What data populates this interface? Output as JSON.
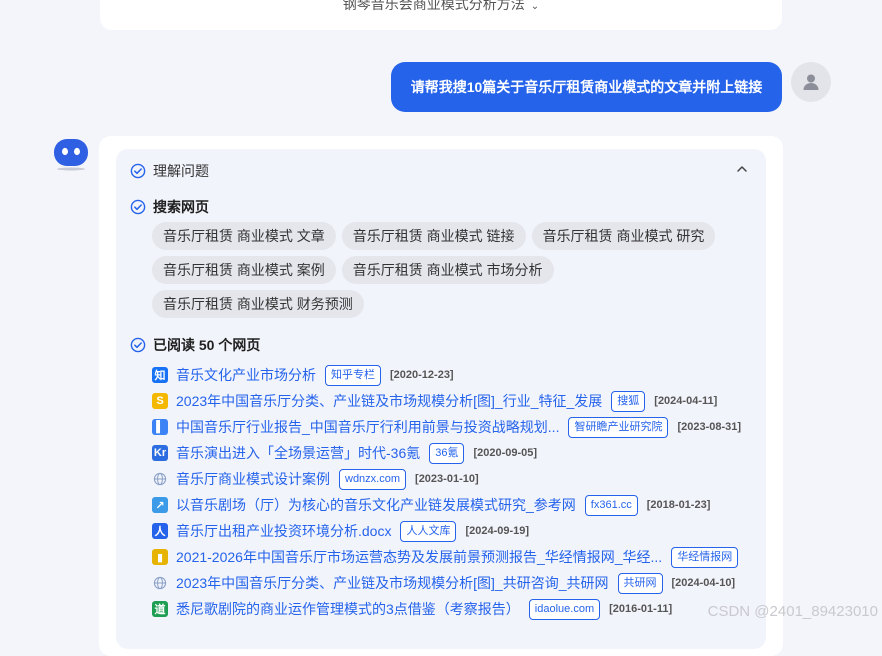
{
  "top": {
    "title": "钢琴音乐会商业模式分析方法"
  },
  "user": {
    "message": "请帮我搜10篇关于音乐厅租赁商业模式的文章并附上链接"
  },
  "steps": {
    "understand": "理解问题",
    "search": "搜索网页",
    "read": "已阅读 50 个网页"
  },
  "search_tags": [
    "音乐厅租赁 商业模式 文章",
    "音乐厅租赁 商业模式 链接",
    "音乐厅租赁 商业模式 研究",
    "音乐厅租赁 商业模式 案例",
    "音乐厅租赁 商业模式 市场分析",
    "音乐厅租赁 商业模式 财务预测"
  ],
  "results": [
    {
      "title": "音乐文化产业市场分析",
      "source": "知乎专栏",
      "date": "[2020-12-23]",
      "icon": "zhihu-icon",
      "icon_char": "知",
      "icon_color": "#1772f6"
    },
    {
      "title": "2023年中国音乐厅分类、产业链及市场规模分析[图]_行业_特征_发展",
      "source": "搜狐",
      "date": "[2024-04-11]",
      "icon": "sohu-icon",
      "icon_char": "S",
      "icon_color": "#f5b800"
    },
    {
      "title": "中国音乐厅行业报告_中国音乐厅行利用前景与投资战略规划...",
      "source": "智研瞻产业研究院",
      "date": "[2023-08-31]",
      "icon": "zhiyan-icon",
      "icon_char": "▌",
      "icon_color": "#3b82f6"
    },
    {
      "title": "音乐演出进入「全场景运营」时代-36氪",
      "source": "36氪",
      "date": "[2020-09-05]",
      "icon": "36kr-icon",
      "icon_char": "Kr",
      "icon_color": "#2b6de0"
    },
    {
      "title": "音乐厅商业模式设计案例",
      "source": "wdnzx.com",
      "date": "[2023-01-10]",
      "icon": "globe-icon",
      "icon_char": "",
      "icon_color": "#8aa0c8"
    },
    {
      "title": "以音乐剧场（厅）为核心的音乐文化产业链发展模式研究_参考网",
      "source": "fx361.cc",
      "date": "[2018-01-23]",
      "icon": "fx361-icon",
      "icon_char": "↗",
      "icon_color": "#3b9be8"
    },
    {
      "title": "音乐厅出租产业投资环境分析.docx",
      "source": "人人文库",
      "date": "[2024-09-19]",
      "icon": "renren-icon",
      "icon_char": "人",
      "icon_color": "#2563eb"
    },
    {
      "title": "2021-2026年中国音乐厅市场运营态势及发展前景预测报告_华经情报网_华经...",
      "source": "华经情报网",
      "date": "",
      "icon": "huajing-icon",
      "icon_char": "▮",
      "icon_color": "#e6b400"
    },
    {
      "title": "2023年中国音乐厅分类、产业链及市场规模分析[图]_共研咨询_共研网",
      "source": "共研网",
      "date": "[2024-04-10]",
      "icon": "globe-icon",
      "icon_char": "",
      "icon_color": "#8aa0c8"
    },
    {
      "title": "悉尼歌剧院的商业运作管理模式的3点借鉴（考察报告）",
      "source": "idaolue.com",
      "date": "[2016-01-11]",
      "icon": "idaolue-icon",
      "icon_char": "道",
      "icon_color": "#1e9e52"
    }
  ],
  "watermark": "CSDN @2401_89423010"
}
